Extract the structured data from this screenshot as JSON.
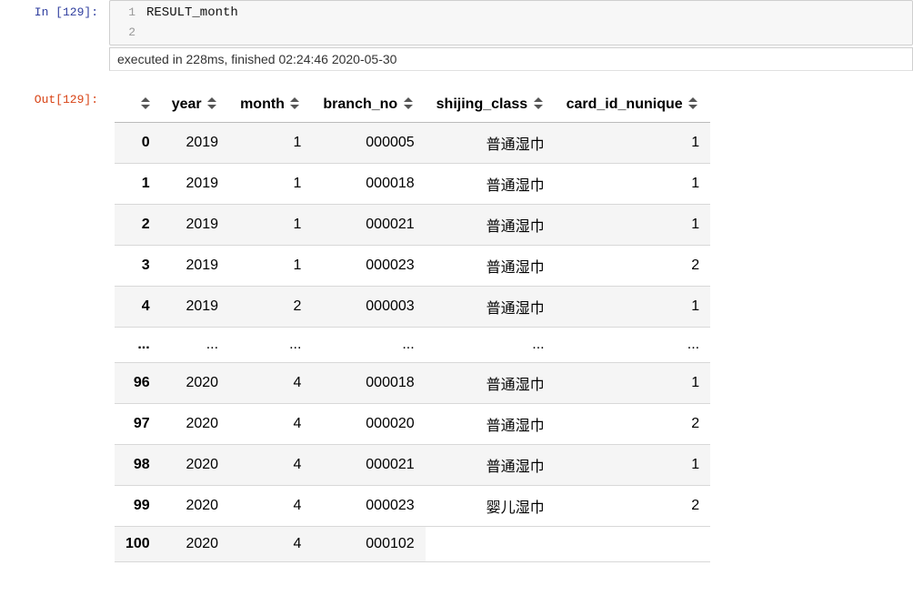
{
  "cell": {
    "in_prompt": "In [129]:",
    "out_prompt": "Out[129]:",
    "code_lines": [
      "RESULT_month",
      ""
    ],
    "exec_info": "executed in 228ms, finished 02:24:46 2020-05-30"
  },
  "table": {
    "columns": [
      "year",
      "month",
      "branch_no",
      "shijing_class",
      "card_id_nunique"
    ],
    "rows": [
      {
        "index": "0",
        "year": "2019",
        "month": "1",
        "branch_no": "000005",
        "shijing_class": "普通湿巾",
        "card_id_nunique": "1"
      },
      {
        "index": "1",
        "year": "2019",
        "month": "1",
        "branch_no": "000018",
        "shijing_class": "普通湿巾",
        "card_id_nunique": "1"
      },
      {
        "index": "2",
        "year": "2019",
        "month": "1",
        "branch_no": "000021",
        "shijing_class": "普通湿巾",
        "card_id_nunique": "1"
      },
      {
        "index": "3",
        "year": "2019",
        "month": "1",
        "branch_no": "000023",
        "shijing_class": "普通湿巾",
        "card_id_nunique": "2"
      },
      {
        "index": "4",
        "year": "2019",
        "month": "2",
        "branch_no": "000003",
        "shijing_class": "普通湿巾",
        "card_id_nunique": "1"
      },
      {
        "index": "...",
        "year": "...",
        "month": "...",
        "branch_no": "...",
        "shijing_class": "...",
        "card_id_nunique": "...",
        "ellipsis": true
      },
      {
        "index": "96",
        "year": "2020",
        "month": "4",
        "branch_no": "000018",
        "shijing_class": "普通湿巾",
        "card_id_nunique": "1"
      },
      {
        "index": "97",
        "year": "2020",
        "month": "4",
        "branch_no": "000020",
        "shijing_class": "普通湿巾",
        "card_id_nunique": "2"
      },
      {
        "index": "98",
        "year": "2020",
        "month": "4",
        "branch_no": "000021",
        "shijing_class": "普通湿巾",
        "card_id_nunique": "1"
      },
      {
        "index": "99",
        "year": "2020",
        "month": "4",
        "branch_no": "000023",
        "shijing_class": "婴儿湿巾",
        "card_id_nunique": "2"
      },
      {
        "index": "100",
        "year": "2020",
        "month": "4",
        "branch_no": "000102",
        "shijing_class": "",
        "card_id_nunique": "",
        "last": true
      }
    ]
  }
}
